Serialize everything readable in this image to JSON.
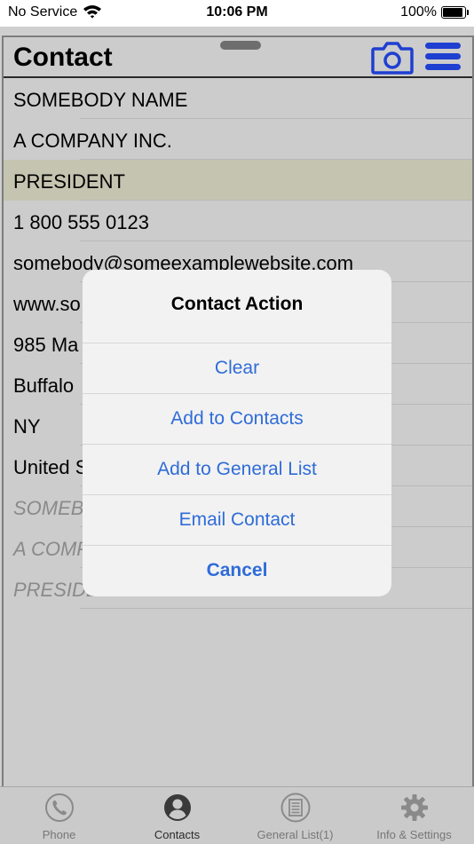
{
  "status_bar": {
    "carrier": "No Service",
    "time": "10:06 PM",
    "battery": "100%"
  },
  "header": {
    "title": "Contact"
  },
  "rows": [
    {
      "text": "SOMEBODY NAME",
      "highlight": false,
      "placeholder": false
    },
    {
      "text": "A COMPANY INC.",
      "highlight": false,
      "placeholder": false
    },
    {
      "text": "PRESIDENT",
      "highlight": true,
      "placeholder": false
    },
    {
      "text": "1 800 555 0123",
      "highlight": false,
      "placeholder": false
    },
    {
      "text": "somebody@someexamplewebsite.com",
      "highlight": false,
      "placeholder": false
    },
    {
      "text": "www.so",
      "highlight": false,
      "placeholder": false
    },
    {
      "text": "985 Ma",
      "highlight": false,
      "placeholder": false
    },
    {
      "text": "Buffalo",
      "highlight": false,
      "placeholder": false
    },
    {
      "text": "NY",
      "highlight": false,
      "placeholder": false
    },
    {
      "text": "United S",
      "highlight": false,
      "placeholder": false
    },
    {
      "text": "SOMEB",
      "highlight": false,
      "placeholder": true
    },
    {
      "text": "A COMP",
      "highlight": false,
      "placeholder": true
    },
    {
      "text": "PRESIDE",
      "highlight": false,
      "placeholder": true
    }
  ],
  "action_sheet": {
    "title": "Contact Action",
    "buttons": [
      "Clear",
      "Add to Contacts",
      "Add to General List",
      "Email Contact"
    ],
    "cancel": "Cancel"
  },
  "tabs": [
    {
      "label": "Phone",
      "icon": "phone-icon",
      "active": false
    },
    {
      "label": "Contacts",
      "icon": "person-icon",
      "active": true
    },
    {
      "label": "General List(1)",
      "icon": "list-icon",
      "active": false
    },
    {
      "label": "Info & Settings",
      "icon": "gear-icon",
      "active": false
    }
  ],
  "colors": {
    "accent": "#2f6cd8",
    "icon_blue": "#1f3fd1",
    "highlight_row": "#c5c4b0"
  }
}
